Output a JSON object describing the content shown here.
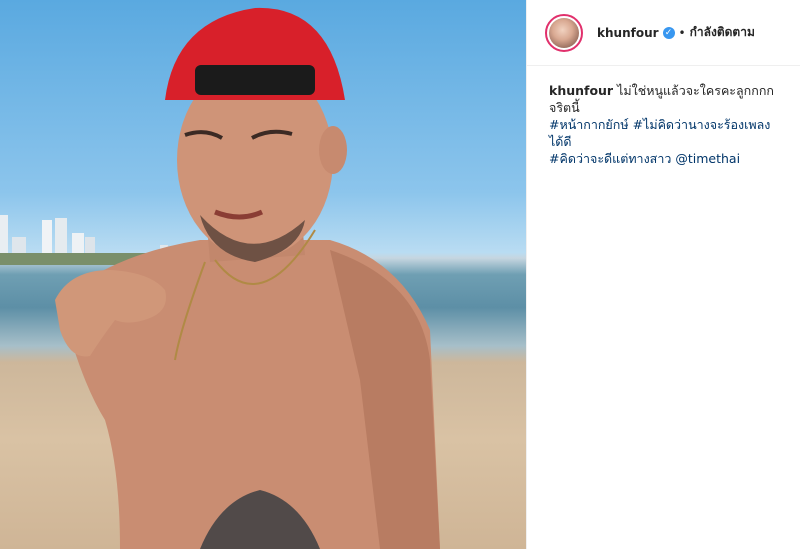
{
  "post": {
    "username": "khunfour",
    "verified": true,
    "separator": "•",
    "follow_label": "กำลังติดตาม",
    "caption": {
      "username": "khunfour",
      "text": "ไม่ใช่หนูแล้วจะใครคะลูกกกก จริตนี้",
      "hashtags": [
        "#หน้ากากยักษ์",
        "#ไม่คิดว่านางจะร้องเพลงได้ดี",
        "#คิดว่าจะดีแต่ทางสาว"
      ],
      "mention": "@timethai"
    }
  },
  "colors": {
    "link": "#003569",
    "verified_badge": "#3897f0",
    "cap_red": "#d8202a"
  },
  "icons": {
    "verified": "verified-check-icon"
  }
}
